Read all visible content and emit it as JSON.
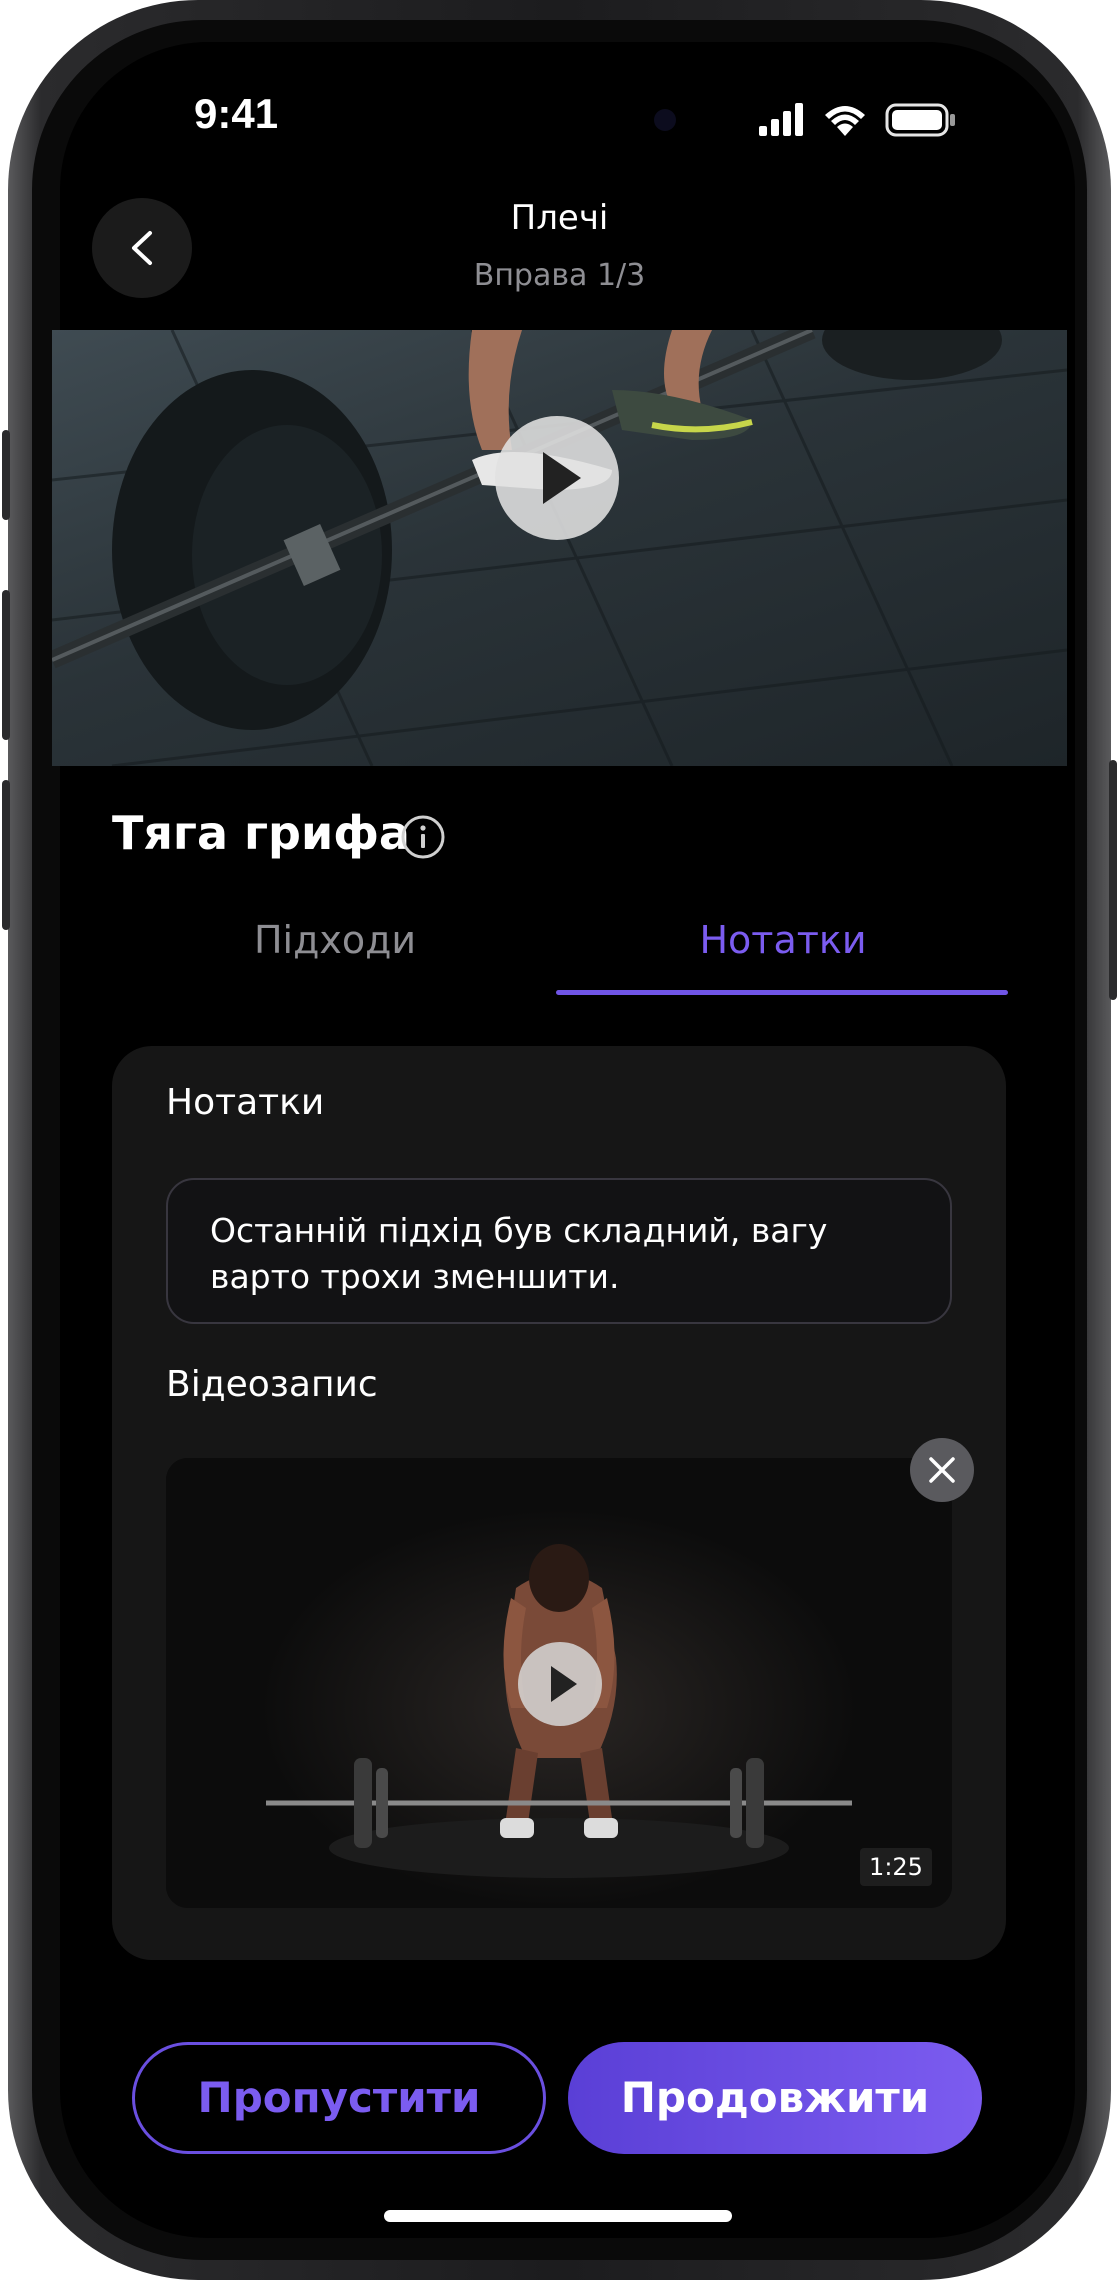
{
  "status_bar": {
    "time": "9:41"
  },
  "header": {
    "title": "Плечі",
    "subtitle": "Вправа 1/3"
  },
  "exercise": {
    "title": "Тяга грифа"
  },
  "tabs": [
    {
      "label": "Підходи",
      "active": false
    },
    {
      "label": "Нотатки",
      "active": true
    }
  ],
  "notes_card": {
    "notes_label": "Нотатки",
    "notes_text": "Останній підхід був складний, вагу варто трохи зменшити.",
    "video_label": "Відеозапис",
    "video_duration": "1:25"
  },
  "actions": {
    "skip_label": "Пропустити",
    "continue_label": "Продовжити"
  },
  "colors": {
    "accent": "#7B5CF0",
    "background": "#000000",
    "card": "#161616",
    "inactive_text": "#8E8E93"
  },
  "icons": {
    "back": "chevron-left-icon",
    "play": "play-icon",
    "info": "info-icon",
    "close": "close-icon",
    "signal": "cellular-signal-icon",
    "wifi": "wifi-icon",
    "battery": "battery-icon"
  }
}
